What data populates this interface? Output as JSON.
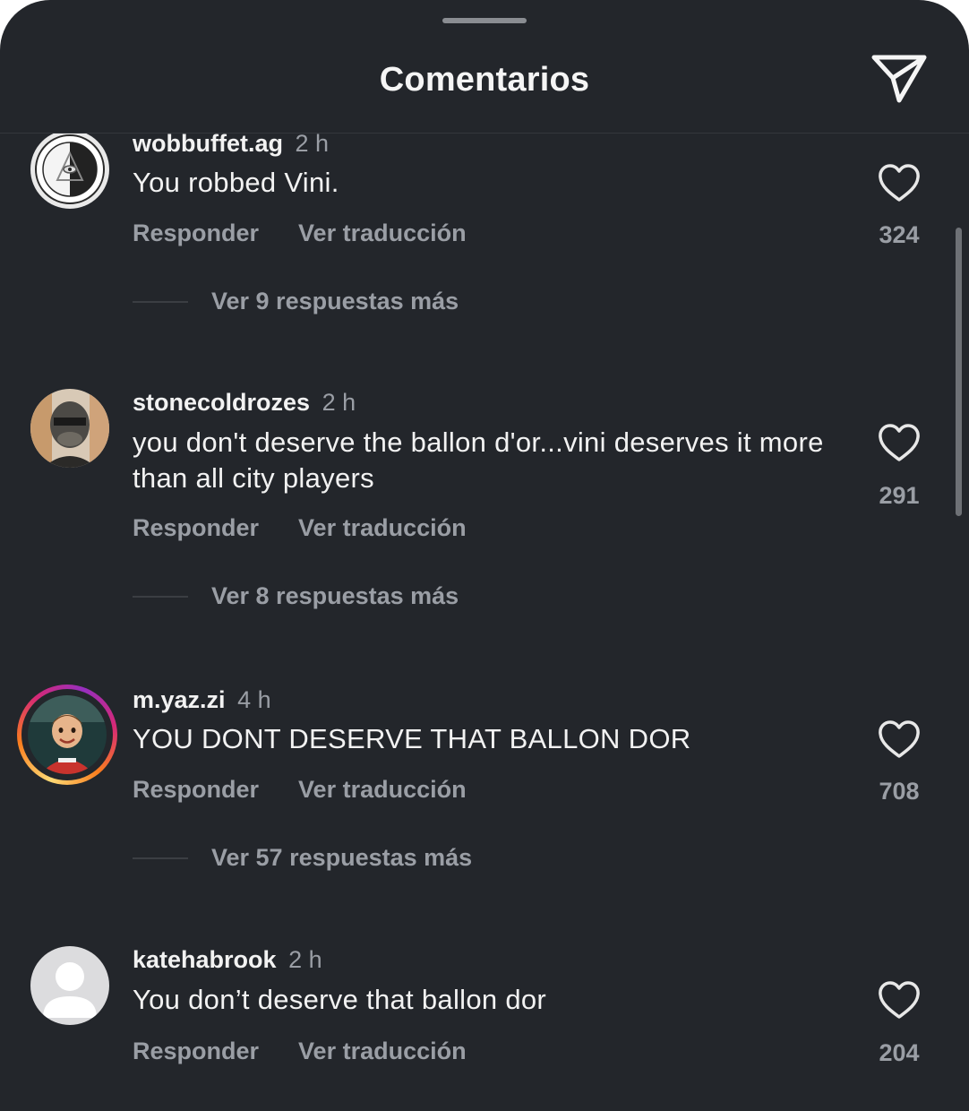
{
  "header": {
    "title": "Comentarios",
    "share_icon": "paper-plane-icon"
  },
  "actions": {
    "reply_label": "Responder",
    "translate_label": "Ver traducción"
  },
  "colors": {
    "background": "#23262b",
    "primary_text": "#f2f2f2",
    "secondary_text": "#9a9ea5",
    "story_ring": "#d62976"
  },
  "comments": [
    {
      "username": "wobbuffet.ag",
      "time": "2 h",
      "text": "You robbed Vini.",
      "likes": "324",
      "replies_label": "Ver 9 respuestas más",
      "avatar": "seal-emblem-avatar"
    },
    {
      "username": "stonecoldrozes",
      "time": "2 h",
      "text": "you don't deserve the ballon d'or...vini deserves it more than all city players",
      "likes": "291",
      "replies_label": "Ver 8 respuestas más",
      "avatar": "masked-face-avatar"
    },
    {
      "username": "m.yaz.zi",
      "time": "4 h",
      "text": "YOU DONT DESERVE THAT BALLON DOR",
      "likes": "708",
      "replies_label": "Ver 57 respuestas más",
      "avatar": "child-photo-avatar",
      "has_story": true
    },
    {
      "username": "katehabrook",
      "time": "2 h",
      "text": "You don’t deserve that ballon dor",
      "likes": "204",
      "avatar": "default-avatar"
    }
  ]
}
